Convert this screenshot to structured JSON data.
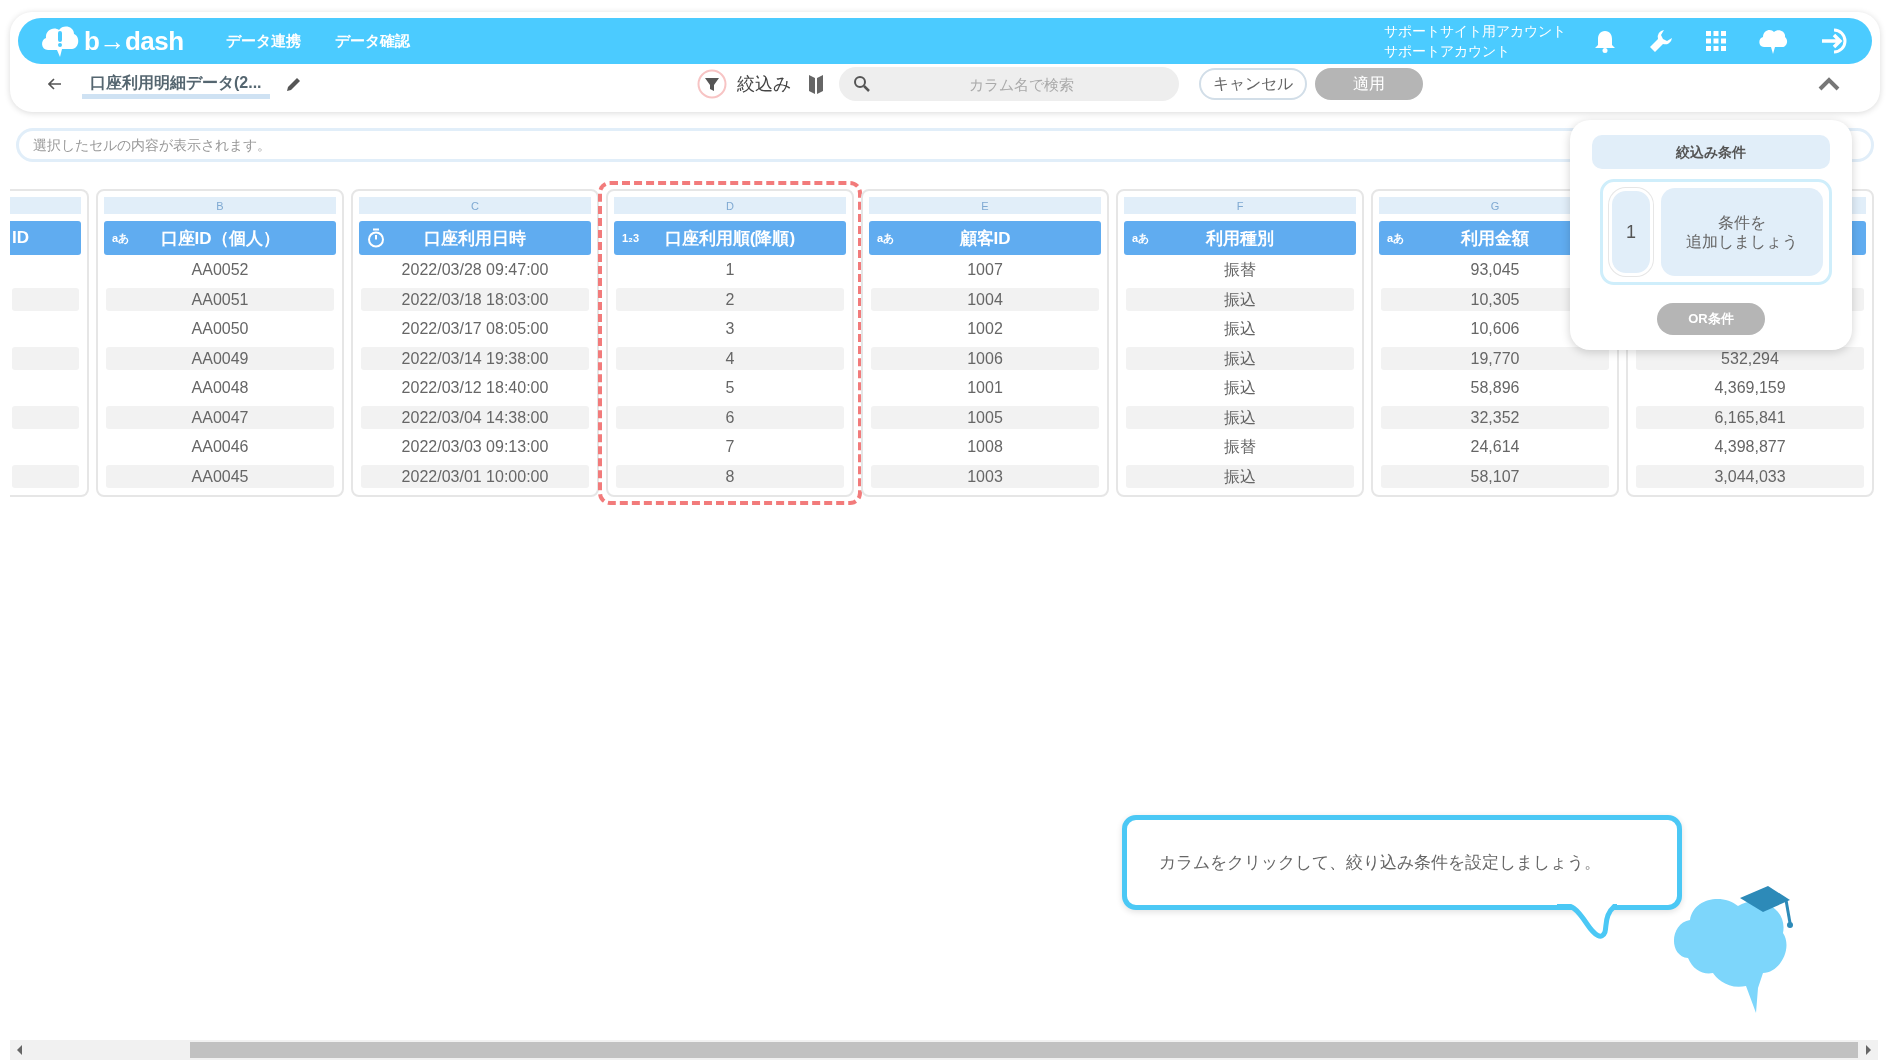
{
  "header": {
    "logo": "b→dash",
    "nav": [
      {
        "label": "データ連携"
      },
      {
        "label": "データ確認"
      }
    ],
    "account": [
      "サポートサイト用アカウント",
      "サポートアカウント"
    ]
  },
  "toolbar": {
    "title": "口座利用明細データ(2...",
    "filter_label": "絞込み",
    "search": {
      "placeholder": "カラム名で検索"
    },
    "buttons": [
      {
        "label": "キャンセル",
        "disabled": false
      },
      {
        "label": "適用",
        "disabled": true
      }
    ]
  },
  "cell_viewer": {
    "placeholder": "選択したセルの内容が表示されます。"
  },
  "columns": [
    {
      "clipped": true,
      "header": "ID",
      "kind": "text",
      "highlighted": false
    },
    {
      "clipped": false,
      "letter": "B",
      "header": "口座ID（個人）",
      "kind": "text",
      "type_badge": "aあ",
      "highlighted": false,
      "cells": [
        "AA0052",
        "AA0051",
        "AA0050",
        "AA0049",
        "AA0048",
        "AA0047",
        "AA0046",
        "AA0045"
      ]
    },
    {
      "clipped": false,
      "letter": "C",
      "header": "口座利用日時",
      "kind": "datetime",
      "highlighted": false,
      "cells": [
        "2022/03/28 09:47:00",
        "2022/03/18 18:03:00",
        "2022/03/17 08:05:00",
        "2022/03/14 19:38:00",
        "2022/03/12 18:40:00",
        "2022/03/04 14:38:00",
        "2022/03/03 09:13:00",
        "2022/03/01 10:00:00"
      ]
    },
    {
      "clipped": false,
      "letter": "D",
      "header": "口座利用順(降順)",
      "kind": "number",
      "type_badge": "1₂3",
      "highlighted": true,
      "cells": [
        "1",
        "2",
        "3",
        "4",
        "5",
        "6",
        "7",
        "8"
      ]
    },
    {
      "clipped": false,
      "letter": "E",
      "header": "顧客ID",
      "kind": "text",
      "type_badge": "aあ",
      "highlighted": false,
      "cells": [
        "1007",
        "1004",
        "1002",
        "1006",
        "1001",
        "1005",
        "1008",
        "1003"
      ]
    },
    {
      "clipped": false,
      "letter": "F",
      "header": "利用種別",
      "kind": "text",
      "type_badge": "aあ",
      "highlighted": false,
      "cells": [
        "振替",
        "振込",
        "振込",
        "振込",
        "振込",
        "振込",
        "振替",
        "振込"
      ]
    },
    {
      "clipped": false,
      "letter": "G",
      "header": "利用金額",
      "kind": "text",
      "type_badge": "aあ",
      "highlighted": false,
      "cells": [
        "93,045",
        "10,305",
        "10,606",
        "19,770",
        "58,896",
        "32,352",
        "24,614",
        "58,107"
      ]
    },
    {
      "clipped": false,
      "kind": "text",
      "highlighted": false,
      "cells": [
        null,
        null,
        null,
        "532,294",
        "4,369,159",
        "6,165,841",
        "4,398,877",
        "3,044,033"
      ]
    }
  ],
  "filter_panel": {
    "title": "絞込み条件",
    "conditions": [
      {
        "number": "1",
        "placeholder_lines": [
          "条件を",
          "追加しましょう"
        ]
      }
    ],
    "or_button": {
      "label": "OR条件",
      "disabled": true
    }
  },
  "tutorial": {
    "message": "カラムをクリックして、絞り込み条件を設定しましょう。"
  }
}
